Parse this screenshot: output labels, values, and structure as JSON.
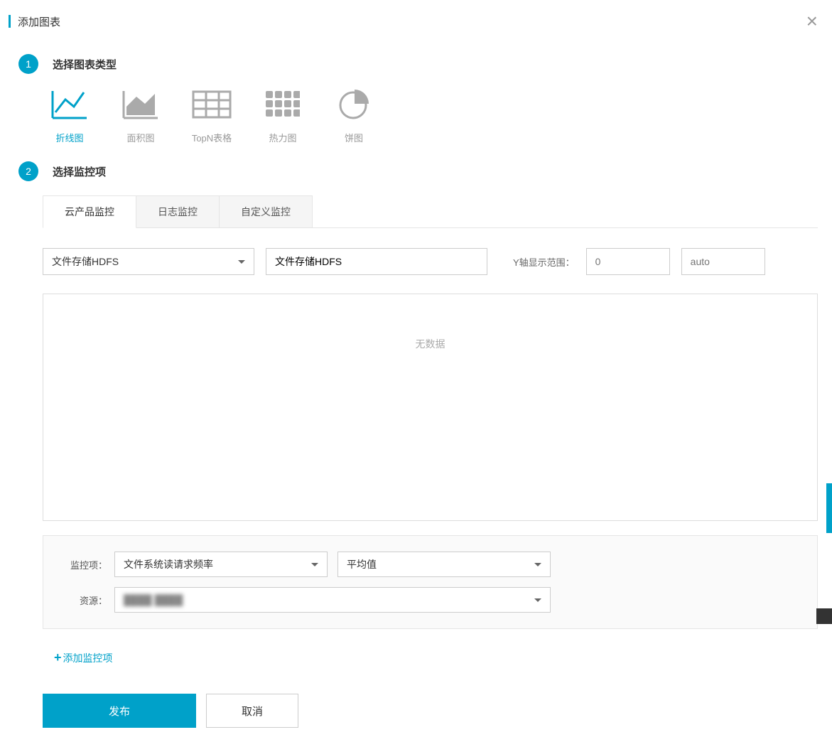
{
  "dialog": {
    "title": "添加图表"
  },
  "steps": {
    "step1": {
      "num": "1",
      "title": "选择图表类型"
    },
    "step2": {
      "num": "2",
      "title": "选择监控项"
    }
  },
  "chartTypes": [
    {
      "label": "折线图",
      "icon": "line",
      "active": true
    },
    {
      "label": "面积图",
      "icon": "area",
      "active": false
    },
    {
      "label": "TopN表格",
      "icon": "table",
      "active": false
    },
    {
      "label": "热力图",
      "icon": "heatmap",
      "active": false
    },
    {
      "label": "饼图",
      "icon": "pie",
      "active": false
    }
  ],
  "tabs": [
    {
      "label": "云产品监控",
      "active": true
    },
    {
      "label": "日志监控",
      "active": false
    },
    {
      "label": "自定义监控",
      "active": false
    }
  ],
  "form": {
    "product_select": "文件存储HDFS",
    "chart_title_input": "文件存储HDFS",
    "yaxis_label": "Y轴显示范围：",
    "yaxis_min_placeholder": "0",
    "yaxis_max_placeholder": "auto"
  },
  "preview": {
    "empty_text": "无数据"
  },
  "monitor": {
    "metric_label": "监控项：",
    "metric_value": "文件系统读请求频率",
    "agg_value": "平均值",
    "resource_label": "资源：",
    "resource_value": "████ ████"
  },
  "addMonitor": {
    "label": "添加监控项"
  },
  "footer": {
    "publish": "发布",
    "cancel": "取消"
  }
}
